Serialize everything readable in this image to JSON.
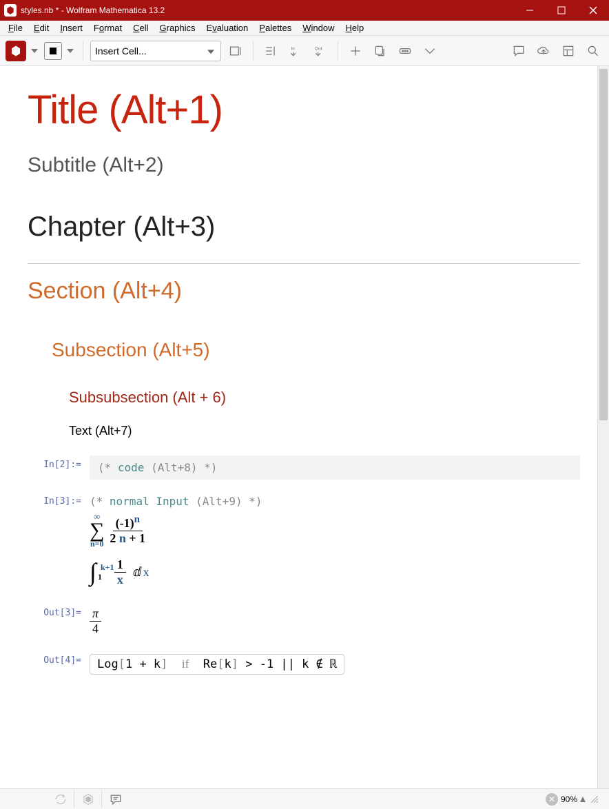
{
  "window": {
    "title": "styles.nb * - Wolfram Mathematica 13.2"
  },
  "menu": {
    "file": "File",
    "edit": "Edit",
    "insert": "Insert",
    "format": "Format",
    "cell": "Cell",
    "graphics": "Graphics",
    "evaluation": "Evaluation",
    "palettes": "Palettes",
    "window": "Window",
    "help": "Help"
  },
  "toolbar": {
    "insert_cell": "Insert Cell..."
  },
  "cells": {
    "title": "Title (Alt+1)",
    "subtitle": "Subtitle (Alt+2)",
    "chapter": "Chapter (Alt+3)",
    "section": "Section (Alt+4)",
    "subsection": "Subsection (Alt+5)",
    "subsubsection": "Subsubsection (Alt + 6)",
    "text": "Text (Alt+7)",
    "code_label": "In[2]:=",
    "code_comment_open": "(* ",
    "code_keyword": "code",
    "code_args": " (Alt+8) ",
    "code_comment_close": "*)",
    "in3_label": "In[3]:=",
    "in3_open": "(* ",
    "in3_kw1": "normal",
    "in3_kw2": "Input",
    "in3_args": " (Alt+9) ",
    "in3_close": "*)",
    "sum_top": "∞",
    "sum_bot": "n=0",
    "sum_num_a": "(-1)",
    "sum_num_exp": "n",
    "sum_den_a": "2 ",
    "sum_den_b": "n",
    "sum_den_c": " + 1",
    "int_top": "k+1",
    "int_bot": "1",
    "int_frac_num": "1",
    "int_frac_den": "x",
    "int_d": "ⅆ",
    "int_var": "x",
    "out3_label": "Out[3]=",
    "out3_num": "π",
    "out3_den": "4",
    "out4_label": "Out[4]=",
    "out4_a": "Log",
    "out4_b": "[",
    "out4_c": "1 + k",
    "out4_d": "]",
    "out4_if": "if",
    "out4_e": "Re",
    "out4_f": "[",
    "out4_g": "k",
    "out4_h": "]",
    "out4_i": " > -1 || k ∉ ℝ"
  },
  "status": {
    "zoom": "90%"
  }
}
